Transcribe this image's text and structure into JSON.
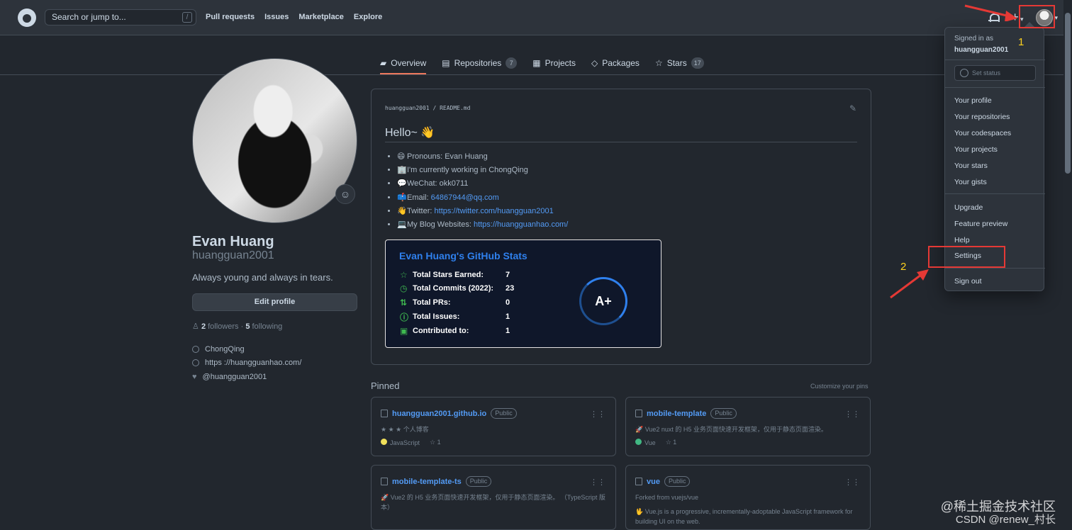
{
  "topbar": {
    "search_placeholder": "Search or jump to...",
    "slash_key": "/",
    "nav": [
      "Pull requests",
      "Issues",
      "Marketplace",
      "Explore"
    ]
  },
  "profile_tabs": [
    {
      "label": "Overview",
      "icon": "book-open-icon",
      "count": ""
    },
    {
      "label": "Repositories",
      "icon": "repository-icon",
      "count": "7"
    },
    {
      "label": "Projects",
      "icon": "project-icon",
      "count": ""
    },
    {
      "label": "Packages",
      "icon": "package-icon",
      "count": ""
    },
    {
      "label": "Stars",
      "icon": "star-icon",
      "count": "17"
    }
  ],
  "profile": {
    "name": "Evan Huang",
    "login": "huangguan2001",
    "bio": "Always young and always in tears.",
    "edit_label": "Edit profile",
    "followers_count": "2",
    "followers_label": "followers",
    "following_count": "5",
    "following_label": "following",
    "location": "ChongQing",
    "website": "https ://huangguanhao.com/",
    "twitter": "@huangguan2001"
  },
  "readme": {
    "owner": "huangguan2001",
    "file": "README.md",
    "heading": "Hello~",
    "heading_emoji": "👋",
    "items": [
      {
        "emoji": "😄",
        "text": "Pronouns: Evan Huang",
        "link": ""
      },
      {
        "emoji": "🏢",
        "text": "I'm currently working in ChongQing",
        "link": ""
      },
      {
        "emoji": "💬",
        "text": "WeChat: okk0711",
        "link": ""
      },
      {
        "emoji": "📫",
        "text": "Email: ",
        "link": "64867944@qq.com"
      },
      {
        "emoji": "👋",
        "text": "Twitter: ",
        "link": "https://twitter.com/huangguan2001"
      },
      {
        "emoji": "💻",
        "text": "My Blog Websites: ",
        "link": "https://huangguanhao.com/"
      }
    ]
  },
  "stats_card": {
    "title": "Evan Huang's GitHub Stats",
    "rows": [
      {
        "icon": "☆",
        "label": "Total Stars Earned:",
        "value": "7"
      },
      {
        "icon": "◷",
        "label": "Total Commits (2022):",
        "value": "23"
      },
      {
        "icon": "⇅",
        "label": "Total PRs:",
        "value": "0"
      },
      {
        "icon": "ⓘ",
        "label": "Total Issues:",
        "value": "1"
      },
      {
        "icon": "▣",
        "label": "Contributed to:",
        "value": "1"
      }
    ],
    "grade": "A+"
  },
  "pinned": {
    "title": "Pinned",
    "customize": "Customize your pins",
    "repos": [
      {
        "name": "huangguan2001.github.io",
        "visibility": "Public",
        "description": "★ ★ ★ 个人博客",
        "language": "JavaScript",
        "language_color": "#f1e05a",
        "stars": "1",
        "forked_from": ""
      },
      {
        "name": "mobile-template",
        "visibility": "Public",
        "description": "🚀 Vue2 nuxt 的 H5 业务页面快速开发框架，仅用于静态页面渲染。",
        "language": "Vue",
        "language_color": "#41b883",
        "stars": "1",
        "forked_from": ""
      },
      {
        "name": "mobile-template-ts",
        "visibility": "Public",
        "description": "🚀 Vue2 的 H5 业务页面快速开发框架，仅用于静态页面渲染。 （TypeScript 版本）",
        "language": "",
        "language_color": "",
        "stars": "",
        "forked_from": ""
      },
      {
        "name": "vue",
        "visibility": "Public",
        "description": "🖖 Vue.js is a progressive, incrementally-adoptable JavaScript framework for building UI on the web.",
        "language": "",
        "language_color": "",
        "stars": "",
        "forked_from": "Forked from vuejs/vue"
      }
    ]
  },
  "dropdown": {
    "signed_in_as": "Signed in as",
    "username": "huangguan2001",
    "set_status": "Set status",
    "items_group_1": [
      "Your profile",
      "Your repositories",
      "Your codespaces",
      "Your projects",
      "Your stars",
      "Your gists"
    ],
    "items_group_2": [
      "Upgrade",
      "Feature preview",
      "Help",
      "Settings"
    ],
    "sign_out": "Sign out"
  },
  "annotations": {
    "step_1": "1",
    "step_2": "2",
    "highlight_color": "#e53935",
    "number_color": "#ffd21f"
  },
  "watermark": {
    "site": "@稀土掘金技术社区",
    "author": "CSDN @renew_村长"
  },
  "colors": {
    "background": "#22272e",
    "header": "#2d333b",
    "link": "#539bf5",
    "active_tab": "#ec775c"
  }
}
